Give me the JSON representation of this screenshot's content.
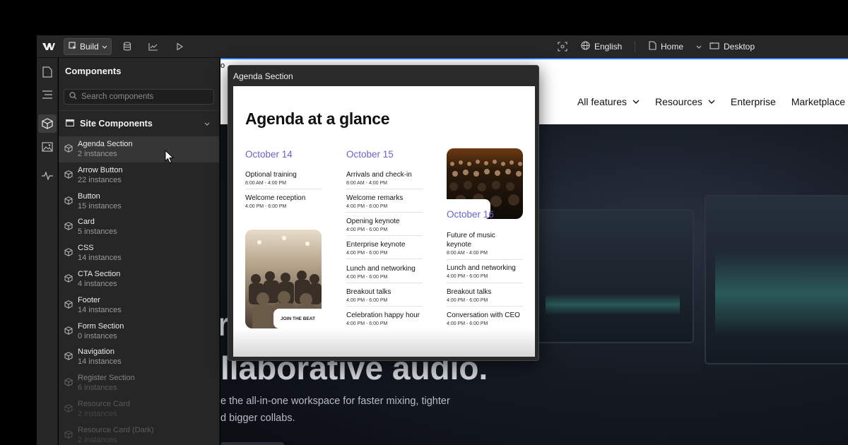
{
  "topbar": {
    "build_label": "Build",
    "language": "English",
    "page": "Home",
    "breakpoint": "Desktop"
  },
  "panel": {
    "title": "Components",
    "search_placeholder": "Search components",
    "section_title": "Site Components",
    "items": [
      {
        "name": "Agenda Section",
        "count": "2 instances"
      },
      {
        "name": "Arrow Button",
        "count": "22 instances"
      },
      {
        "name": "Button",
        "count": "15 instances"
      },
      {
        "name": "Card",
        "count": "5 instances"
      },
      {
        "name": "CSS",
        "count": "14 instances"
      },
      {
        "name": "CTA Section",
        "count": "4 instances"
      },
      {
        "name": "Footer",
        "count": "14 instances"
      },
      {
        "name": "Form Section",
        "count": "0 instances"
      },
      {
        "name": "Navigation",
        "count": "14 instances"
      },
      {
        "name": "Register Section",
        "count": "6 instances"
      },
      {
        "name": "Resource Card",
        "count": "2 instances"
      },
      {
        "name": "Resource Card (Dark)",
        "count": "2 instances"
      }
    ]
  },
  "canvas": {
    "crumb": "o",
    "nav": [
      "All features",
      "Resources",
      "Enterprise",
      "Marketplace"
    ],
    "hero_line1": "r",
    "hero_line2": "llaborative audio.",
    "hero_sub1": "e the all-in-one workspace for faster mixing, tighter",
    "hero_sub2": "d bigger collabs."
  },
  "preview": {
    "title": "Agenda Section",
    "heading": "Agenda at a glance",
    "join_label": "JOIN THE BEAT",
    "days": [
      {
        "label": "October 14",
        "events": [
          {
            "title": "Optional training",
            "time": "8:00 AM - 4:00 PM"
          },
          {
            "title": "Welcome reception",
            "time": "4:00 PM - 6:00 PM"
          }
        ]
      },
      {
        "label": "October 15",
        "events": [
          {
            "title": "Arrivals and check-in",
            "time": "8:00 AM - 4:00 PM"
          },
          {
            "title": "Welcome remarks",
            "time": "4:00 PM - 6:00 PM"
          },
          {
            "title": "Opening keynote",
            "time": "4:00 PM - 6:00 PM"
          },
          {
            "title": "Enterprise keynote",
            "time": "4:00 PM - 6:00 PM"
          },
          {
            "title": "Lunch and networking",
            "time": "4:00 PM - 6:00 PM"
          },
          {
            "title": "Breakout talks",
            "time": "4:00 PM - 6:00 PM"
          },
          {
            "title": "Celebration happy hour",
            "time": "4:00 PM - 6:00 PM"
          }
        ]
      },
      {
        "label": "October 16",
        "events": [
          {
            "title": "Future of music keynote",
            "time": "8:00 AM - 4:00 PM"
          },
          {
            "title": "Lunch and networking",
            "time": "4:00 PM - 6:00 PM"
          },
          {
            "title": "Breakout talks",
            "time": "4:00 PM - 6:00 PM"
          },
          {
            "title": "Conversation with CEO",
            "time": "4:00 PM - 6:00 PM"
          }
        ]
      }
    ]
  },
  "colors": {
    "accent_day": "#6a63c9",
    "selection_blue": "#2f7bf6",
    "panel_bg": "#262626"
  }
}
